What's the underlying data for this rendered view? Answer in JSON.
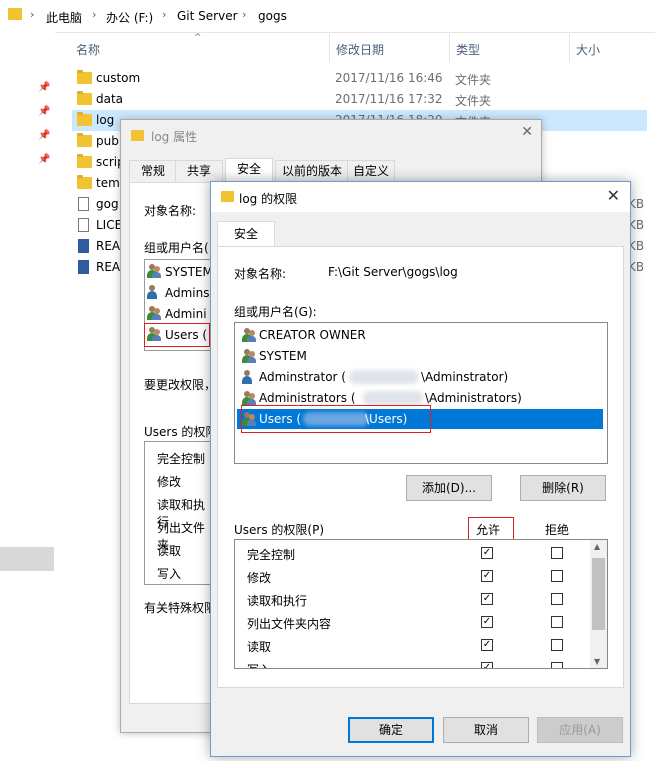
{
  "explorer": {
    "breadcrumb": [
      "此电脑",
      "办公 (F:)",
      "Git Server",
      "gogs"
    ],
    "columns": {
      "name": "名称",
      "date": "修改日期",
      "type": "类型",
      "size": "大小"
    },
    "rows": [
      {
        "name": "custom",
        "date": "2017/11/16 16:46",
        "type": "文件夹",
        "size": ""
      },
      {
        "name": "data",
        "date": "2017/11/16 17:32",
        "type": "文件夹",
        "size": ""
      },
      {
        "name": "log",
        "date": "2017/11/16 18:20",
        "type": "文件夹",
        "size": ""
      },
      {
        "name": "publ",
        "date": "",
        "type": "",
        "size": ""
      },
      {
        "name": "scrip",
        "date": "",
        "type": "",
        "size": ""
      },
      {
        "name": "temp",
        "date": "",
        "type": "",
        "size": ""
      },
      {
        "name": "gog",
        "date": "",
        "type": "",
        "size": "KB"
      },
      {
        "name": "LICE",
        "date": "",
        "type": "",
        "size": "KB"
      },
      {
        "name": "REA",
        "date": "",
        "type": "",
        "size": "KB"
      },
      {
        "name": "REA",
        "date": "",
        "type": "",
        "size": "KB"
      }
    ]
  },
  "props_dialog": {
    "title": "log 属性",
    "tabs": [
      "常规",
      "共享",
      "安全",
      "以前的版本",
      "自定义"
    ],
    "object_label": "对象名称:",
    "group_label": "组或用户名(",
    "users": [
      "SYSTEM",
      "Admins",
      "Admini",
      "Users ("
    ],
    "change_text": "要更改权限，",
    "perm_label": "Users 的权限",
    "perms": [
      "完全控制",
      "修改",
      "读取和执行",
      "列出文件夹",
      "读取",
      "写入"
    ],
    "special": "有关特殊权限"
  },
  "perm_dialog": {
    "title": "log 的权限",
    "tab": "安全",
    "object_label": "对象名称:",
    "object_value": "F:\\Git Server\\gogs\\log",
    "group_label": "组或用户名(G):",
    "users": [
      {
        "name": "CREATOR OWNER"
      },
      {
        "name": "SYSTEM"
      },
      {
        "name": "Adminstrator (",
        "suffix": "\\Adminstrator)"
      },
      {
        "name": "Administrators (",
        "suffix": "\\Administrators)"
      },
      {
        "name": "Users (",
        "suffix": "\\Users)"
      }
    ],
    "add_button": "添加(D)...",
    "remove_button": "删除(R)",
    "perm_label": "Users 的权限(P)",
    "allow_header": "允许",
    "deny_header": "拒绝",
    "permissions": [
      {
        "name": "完全控制",
        "allow": true,
        "deny": false
      },
      {
        "name": "修改",
        "allow": true,
        "deny": false
      },
      {
        "name": "读取和执行",
        "allow": true,
        "deny": false
      },
      {
        "name": "列出文件夹内容",
        "allow": true,
        "deny": false
      },
      {
        "name": "读取",
        "allow": true,
        "deny": false
      },
      {
        "name": "写入",
        "allow": true,
        "deny": false
      }
    ],
    "ok_button": "确定",
    "cancel_button": "取消",
    "apply_button": "应用(A)"
  }
}
